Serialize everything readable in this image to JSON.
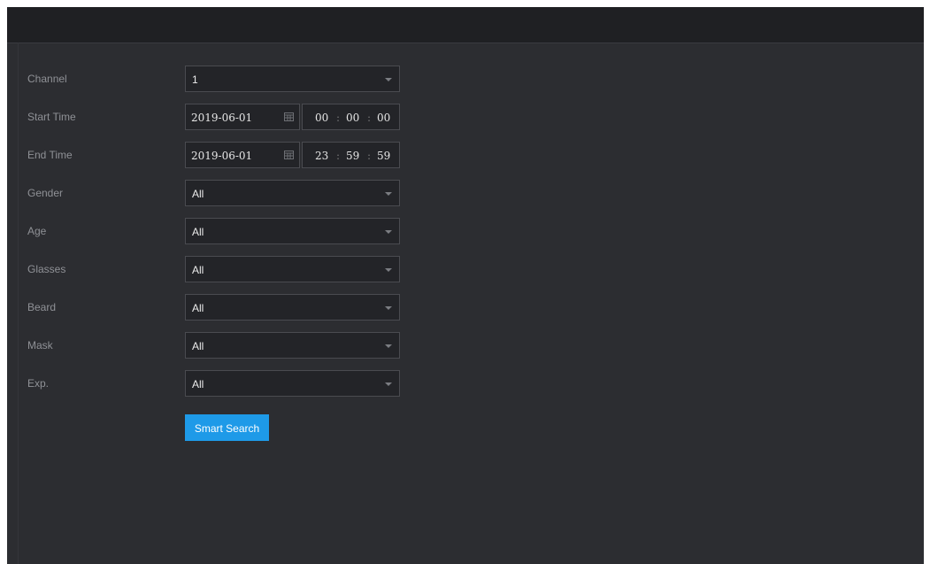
{
  "form": {
    "channel": {
      "label": "Channel",
      "value": "1"
    },
    "start_time": {
      "label": "Start Time",
      "date": "2019-06-01",
      "hh": "00",
      "mm": "00",
      "ss": "00"
    },
    "end_time": {
      "label": "End Time",
      "date": "2019-06-01",
      "hh": "23",
      "mm": "59",
      "ss": "59"
    },
    "gender": {
      "label": "Gender",
      "value": "All"
    },
    "age": {
      "label": "Age",
      "value": "All"
    },
    "glasses": {
      "label": "Glasses",
      "value": "All"
    },
    "beard": {
      "label": "Beard",
      "value": "All"
    },
    "mask": {
      "label": "Mask",
      "value": "All"
    },
    "exp": {
      "label": "Exp.",
      "value": "All"
    }
  },
  "time_separator": ":",
  "actions": {
    "smart_search_label": "Smart Search"
  },
  "colors": {
    "accent": "#1e9ae8",
    "background": "#2c2d31",
    "titlebar": "#1f2023"
  },
  "icons": {
    "dropdown": "chevron-down-icon",
    "calendar": "calendar-icon"
  }
}
